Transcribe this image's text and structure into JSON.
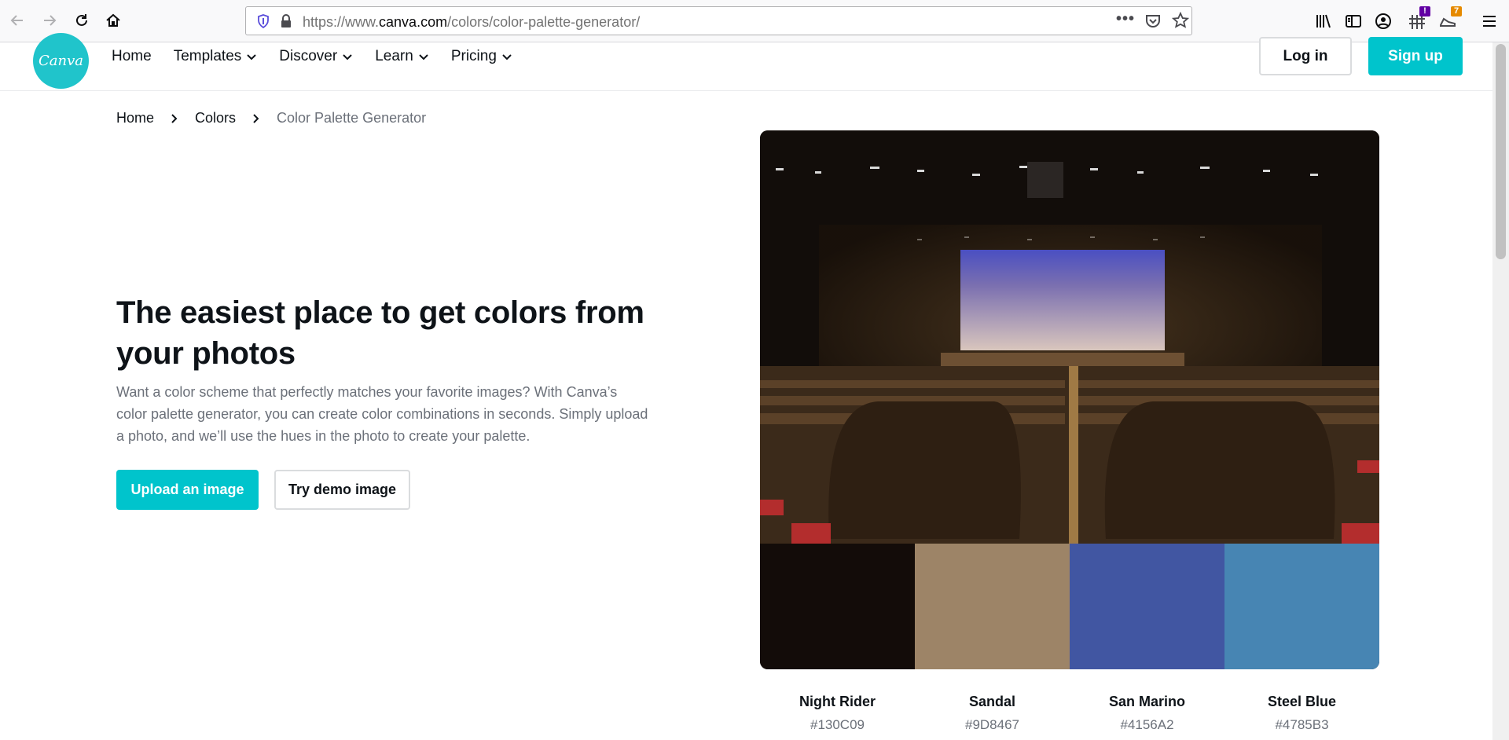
{
  "browser": {
    "url_prefix": "https://www.",
    "url_host": "canva.com",
    "url_path": "/colors/color-palette-generator/",
    "more_icon": "ellipsis-icon",
    "badge_count_1": "!",
    "badge_count_2": "7"
  },
  "header": {
    "logo_text": "Canva",
    "nav": [
      {
        "label": "Home"
      },
      {
        "label": "Templates"
      },
      {
        "label": "Discover"
      },
      {
        "label": "Learn"
      },
      {
        "label": "Pricing"
      }
    ],
    "login_label": "Log in",
    "signup_label": "Sign up"
  },
  "breadcrumb": {
    "items": [
      "Home",
      "Colors",
      "Color Palette Generator"
    ]
  },
  "hero": {
    "title": "The easiest place to get colors from your photos",
    "description": "Want a color scheme that perfectly matches your favorite images? With Canva’s color palette generator, you can create color combinations in seconds. Simply upload a photo, and we’ll use the hues in the photo to create your palette.",
    "upload_label": "Upload an image",
    "demo_label": "Try demo image"
  },
  "palette": {
    "swatches": [
      {
        "name": "Night Rider",
        "hex": "#130C09"
      },
      {
        "name": "Sandal",
        "hex": "#9D8467"
      },
      {
        "name": "San Marino",
        "hex": "#4156A2"
      },
      {
        "name": "Steel Blue",
        "hex": "#4785B3"
      }
    ]
  },
  "colors": {
    "accent": "#00C4CC",
    "text": "#0E1318",
    "muted": "#6B7079"
  }
}
